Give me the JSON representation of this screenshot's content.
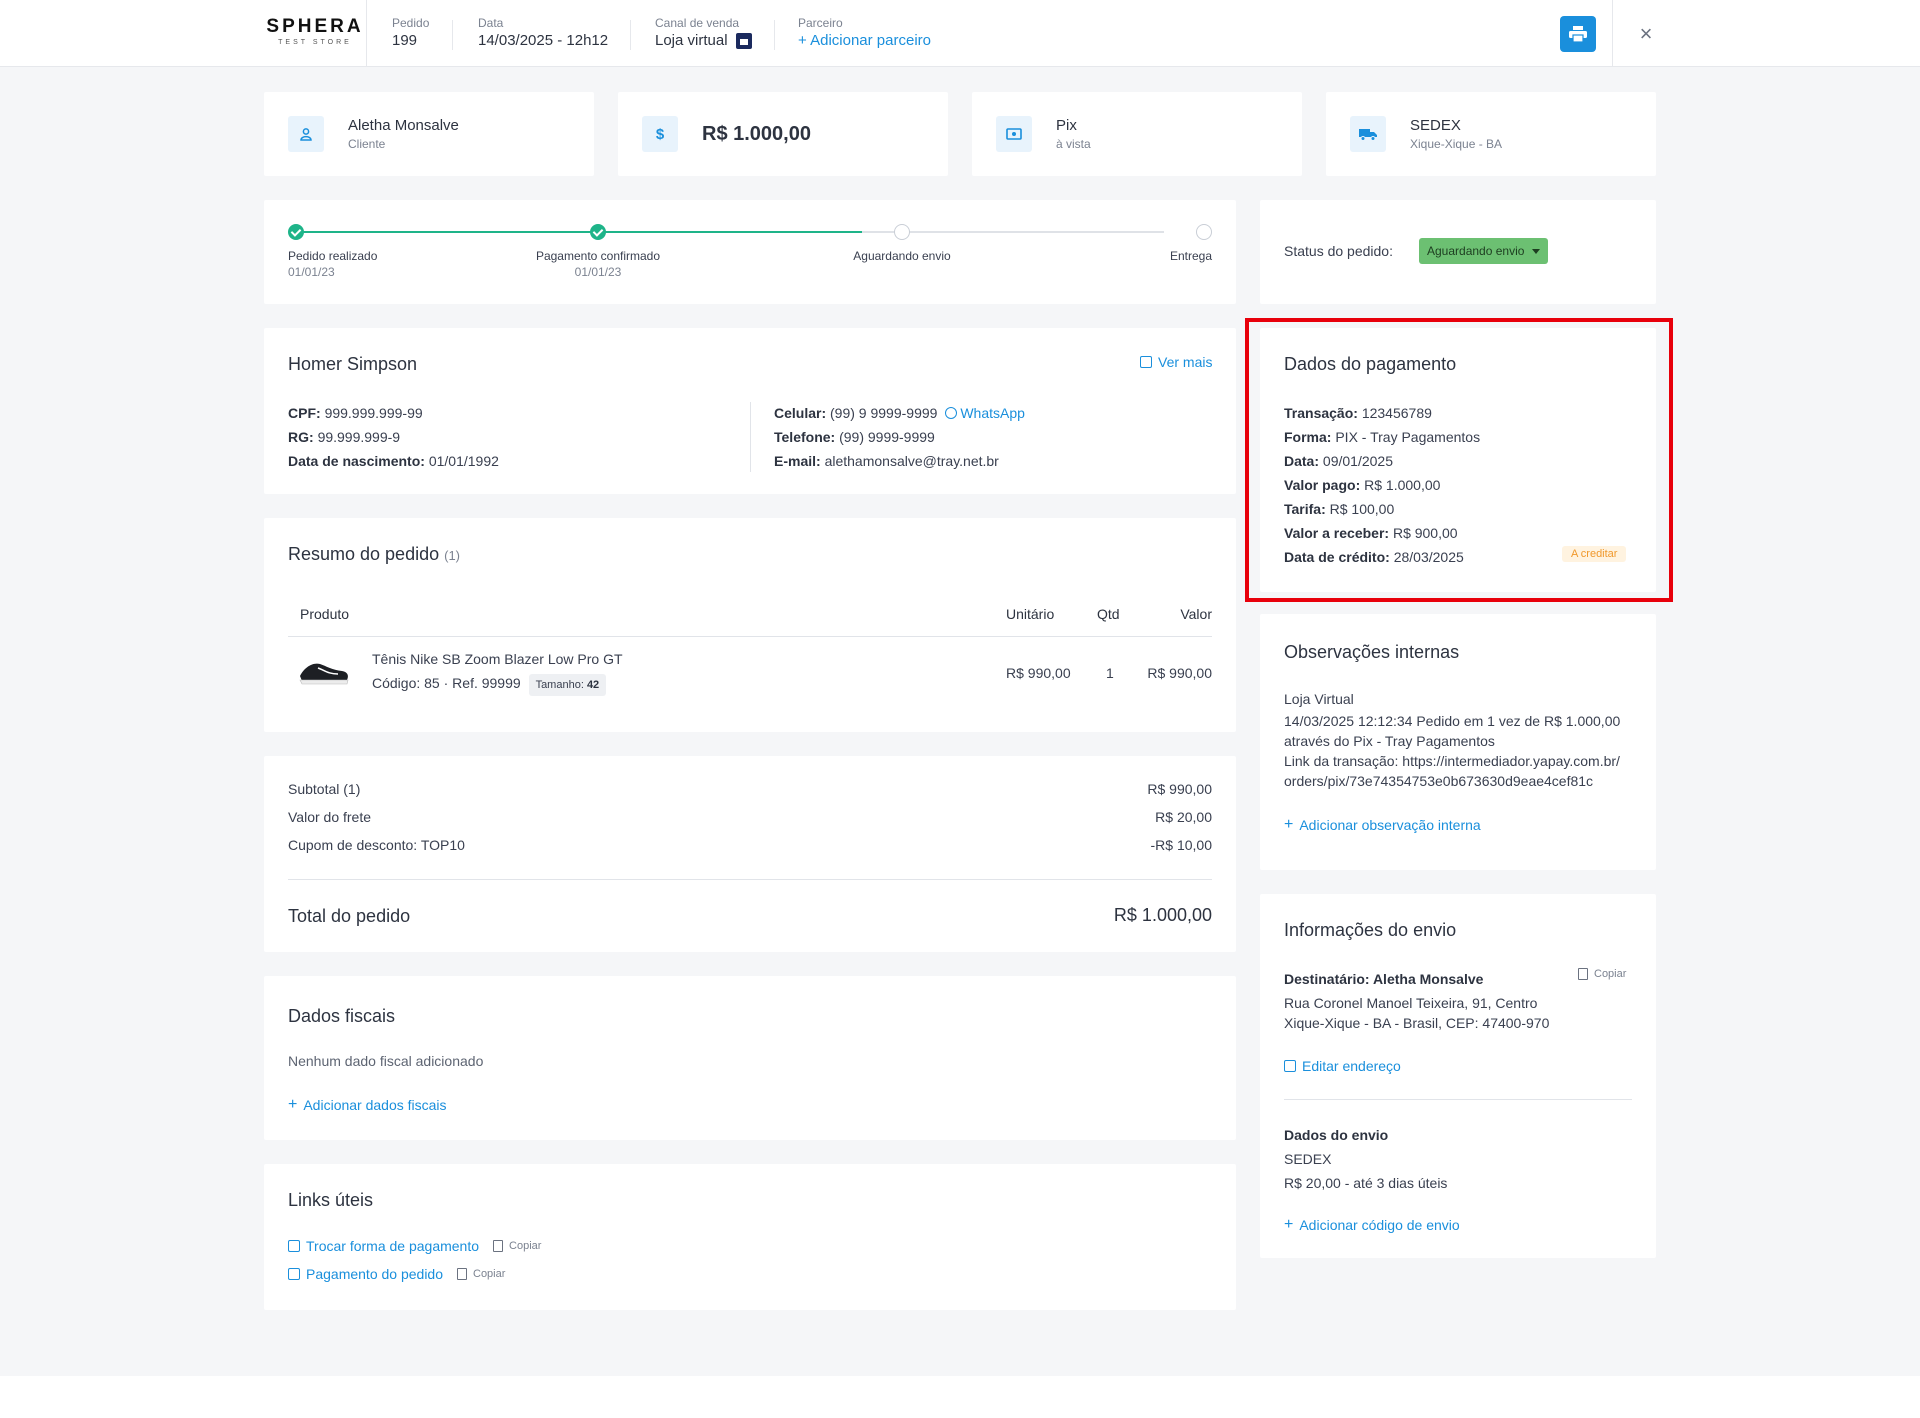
{
  "header": {
    "logo_main": "SPHERA",
    "logo_sub": "TEST STORE",
    "order_label": "Pedido",
    "order_value": "199",
    "date_label": "Data",
    "date_value": "14/03/2025 - 12h12",
    "channel_label": "Canal de venda",
    "channel_value": "Loja virtual",
    "partner_label": "Parceiro",
    "partner_action": "+ Adicionar parceiro",
    "close_symbol": "×"
  },
  "summary_cards": {
    "customer_name": "Aletha Monsalve",
    "customer_role": "Cliente",
    "amount": "R$ 1.000,00",
    "amount_icon": "$",
    "payment_method": "Pix",
    "payment_terms": "à vista",
    "shipping_method": "SEDEX",
    "shipping_location": "Xique-Xique - BA"
  },
  "timeline": {
    "steps": [
      {
        "label": "Pedido realizado",
        "date": "01/01/23",
        "done": true
      },
      {
        "label": "Pagamento confirmado",
        "date": "01/01/23",
        "done": true
      },
      {
        "label": "Aguardando envio",
        "date": "",
        "done": false
      },
      {
        "label": "Entrega",
        "date": "",
        "done": false
      }
    ]
  },
  "status": {
    "label": "Status do pedido:",
    "value": "Aguardando envio"
  },
  "customer": {
    "name": "Homer Simpson",
    "see_more": "Ver mais",
    "cpf_label": "CPF:",
    "cpf": "999.999.999-99",
    "rg_label": "RG:",
    "rg": "99.999.999-9",
    "birth_label": "Data de nascimento:",
    "birth": "01/01/1992",
    "cell_label": "Celular:",
    "cell": "(99) 9 9999-9999",
    "whatsapp": "WhatsApp",
    "phone_label": "Telefone:",
    "phone": "(99) 9999-9999",
    "email_label": "E-mail:",
    "email": "alethamonsalve@tray.net.br"
  },
  "order_summary": {
    "title": "Resumo do pedido",
    "count": "(1)",
    "columns": {
      "product": "Produto",
      "unit": "Unitário",
      "qty": "Qtd",
      "value": "Valor"
    },
    "items": [
      {
        "name": "Tênis Nike SB Zoom Blazer Low Pro GT",
        "code": "Código: 85",
        "ref": "Ref. 99999",
        "size_label": "Tamanho:",
        "size": "42",
        "unit": "R$ 990,00",
        "qty": "1",
        "value": "R$ 990,00"
      }
    ]
  },
  "totals": {
    "subtotal_label": "Subtotal (1)",
    "subtotal": "R$ 990,00",
    "shipping_label": "Valor do frete",
    "shipping": "R$ 20,00",
    "coupon_label": "Cupom de desconto: TOP10",
    "coupon": "-R$ 10,00",
    "total_label": "Total do pedido",
    "total": "R$ 1.000,00"
  },
  "fiscal": {
    "title": "Dados fiscais",
    "empty": "Nenhum dado fiscal adicionado",
    "add": "Adicionar dados fiscais"
  },
  "links": {
    "title": "Links úteis",
    "items": [
      {
        "label": "Trocar forma de pagamento",
        "copy": "Copiar"
      },
      {
        "label": "Pagamento do pedido",
        "copy": "Copiar"
      }
    ]
  },
  "payment": {
    "title": "Dados do pagamento",
    "transaction_label": "Transação:",
    "transaction": "123456789",
    "form_label": "Forma:",
    "form": "PIX - Tray Pagamentos",
    "date_label": "Data:",
    "date": "09/01/2025",
    "paid_label": "Valor pago:",
    "paid": "R$ 1.000,00",
    "fee_label": "Tarifa:",
    "fee": "R$ 100,00",
    "receivable_label": "Valor a receber:",
    "receivable": "R$ 900,00",
    "credit_label": "Data de crédito:",
    "credit": "28/03/2025",
    "credit_badge": "A creditar"
  },
  "notes": {
    "title": "Observações internas",
    "source": "Loja Virtual",
    "lines": [
      "14/03/2025 12:12:34 Pedido em 1 vez de R$ 1.000,00",
      "através do Pix - Tray Pagamentos",
      "Link da transação: https://intermediador.yapay.com.br/",
      "orders/pix/73e74354753e0b673630d9eae4cef81c"
    ],
    "add": "Adicionar observação interna"
  },
  "shipping_info": {
    "title": "Informações do envio",
    "recipient": "Destinatário: Aletha Monsalve",
    "copy": "Copiar",
    "address_1": "Rua Coronel Manoel Teixeira, 91, Centro",
    "address_2": "Xique-Xique - BA - Brasil, CEP: 47400-970",
    "edit": "Editar endereço",
    "data_title": "Dados do envio",
    "carrier": "SEDEX",
    "price": "R$ 20,00 - até 3 dias úteis",
    "add_code": "Adicionar código de envio"
  },
  "colors": {
    "accent": "#1a8fdc",
    "success": "#1eb489",
    "status": "#6cc072",
    "highlight": "#e8000b"
  }
}
